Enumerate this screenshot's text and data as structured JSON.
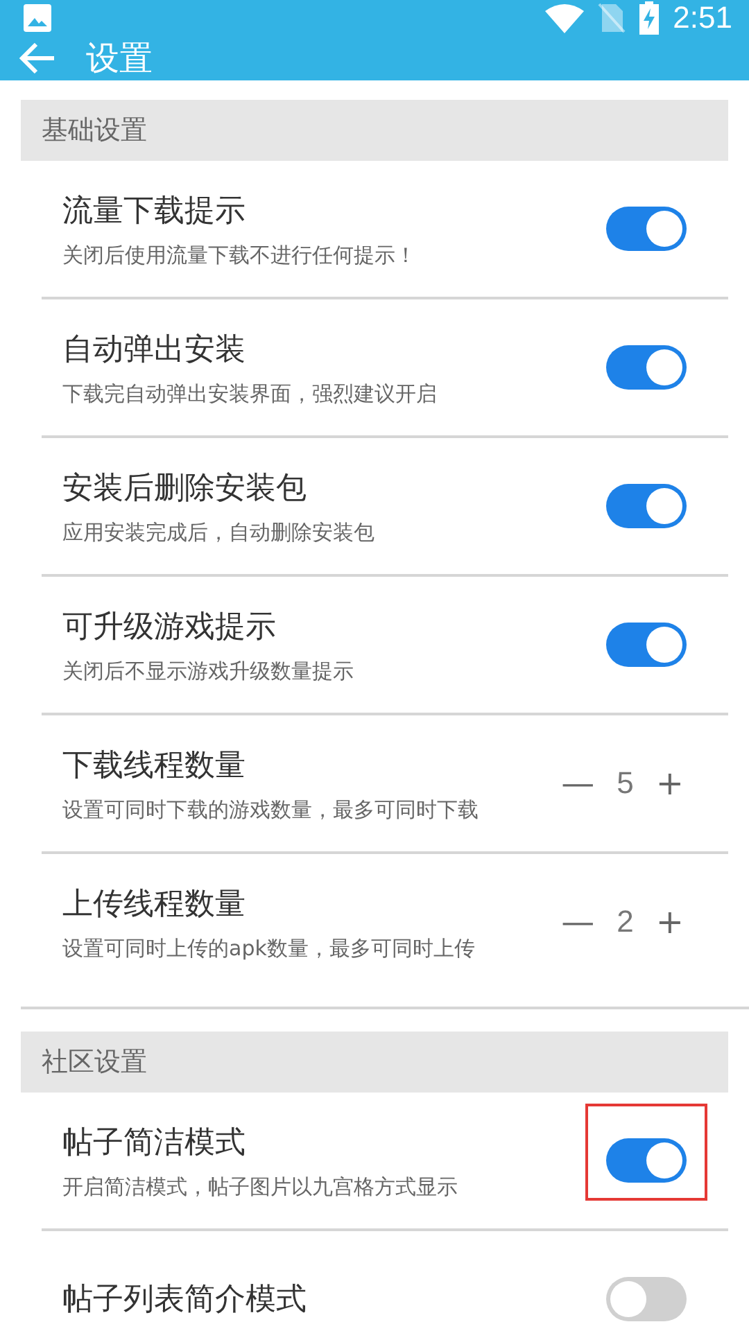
{
  "status_bar": {
    "time": "2:51"
  },
  "app_bar": {
    "title": "设置"
  },
  "sections": [
    {
      "title": "基础设置",
      "items": [
        {
          "kind": "toggle",
          "title": "流量下载提示",
          "subtitle": "关闭后使用流量下载不进行任何提示！",
          "on": true,
          "highlighted": false
        },
        {
          "kind": "toggle",
          "title": "自动弹出安装",
          "subtitle": "下载完自动弹出安装界面，强烈建议开启",
          "on": true,
          "highlighted": false
        },
        {
          "kind": "toggle",
          "title": "安装后删除安装包",
          "subtitle": "应用安装完成后，自动删除安装包",
          "on": true,
          "highlighted": false
        },
        {
          "kind": "toggle",
          "title": "可升级游戏提示",
          "subtitle": "关闭后不显示游戏升级数量提示",
          "on": true,
          "highlighted": false
        },
        {
          "kind": "stepper",
          "title": "下载线程数量",
          "subtitle": "设置可同时下载的游戏数量，最多可同时下载",
          "value": "5",
          "minus": "—",
          "plus": "+"
        },
        {
          "kind": "stepper",
          "title": "上传线程数量",
          "subtitle": "设置可同时上传的apk数量，最多可同时上传",
          "value": "2",
          "minus": "—",
          "plus": "+"
        }
      ]
    },
    {
      "title": "社区设置",
      "items": [
        {
          "kind": "toggle",
          "title": "帖子简洁模式",
          "subtitle": "开启简洁模式，帖子图片以九宫格方式显示",
          "on": true,
          "highlighted": true
        },
        {
          "kind": "toggle",
          "title": "帖子列表简介模式",
          "on": false,
          "highlighted": false
        }
      ]
    }
  ]
}
